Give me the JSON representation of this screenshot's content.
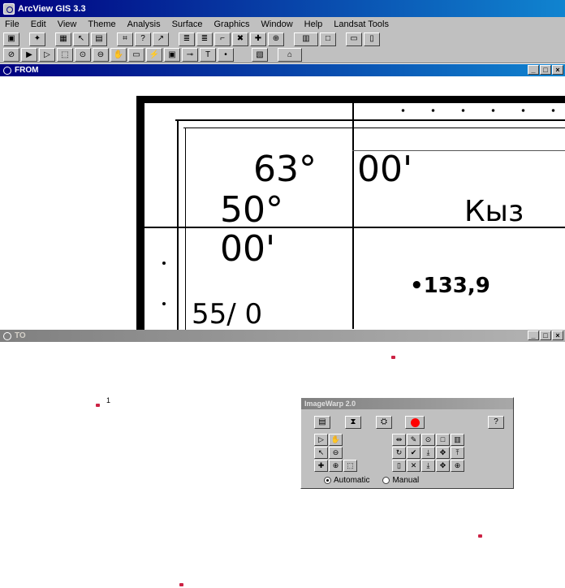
{
  "app": {
    "title": "ArcView GIS 3.3"
  },
  "menu": [
    "File",
    "Edit",
    "View",
    "Theme",
    "Analysis",
    "Surface",
    "Graphics",
    "Window",
    "Help",
    "Landsat Tools"
  ],
  "toolbar1": [
    "▣",
    "✦",
    "▦",
    "↖",
    "▤",
    "⌗",
    "?",
    "↗",
    "≣",
    "≣",
    "⌐",
    "✖",
    "✚",
    "⊕",
    "▥",
    "□",
    "▭",
    "▯"
  ],
  "toolbar2": [
    "⊘",
    "▶",
    "▷",
    "⬚",
    "⊙",
    "⊖",
    "✋",
    "▭",
    "⚡",
    "▣",
    "⊸",
    "T",
    "•",
    "▧",
    "⌂"
  ],
  "windows": {
    "from": {
      "title": "FROM"
    },
    "to": {
      "title": "TO"
    }
  },
  "map": {
    "lon_deg": "63°",
    "lon_min": "00'",
    "lat_deg": "50°",
    "lat_min": "00'",
    "place": "Кыз",
    "elevation": "•133,9",
    "partial": "55/ 0"
  },
  "gcp": {
    "label": "1"
  },
  "imagewarp": {
    "title": "ImageWarp 2.0",
    "help_label": "?",
    "auto_label": "Automatic",
    "manual_label": "Manual",
    "mode": "Automatic",
    "record_color": "#ff0000"
  },
  "colors": {
    "title_active": "#000080",
    "gcp_point": "#cc2244"
  }
}
